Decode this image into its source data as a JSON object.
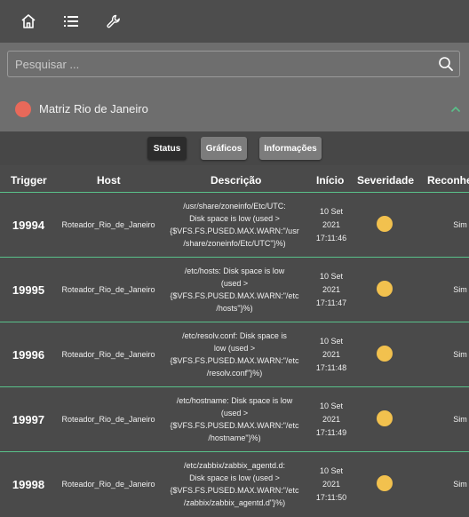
{
  "nav": {
    "icons": [
      "home-icon",
      "list-icon",
      "wrench-icon"
    ]
  },
  "search": {
    "placeholder": "Pesquisar ..."
  },
  "location": {
    "name": "Matriz Rio de Janeiro",
    "status_color": "#e8695a"
  },
  "tabs": [
    {
      "label": "Status",
      "active": true
    },
    {
      "label": "Gráficos",
      "active": false
    },
    {
      "label": "Informações",
      "active": false
    }
  ],
  "table": {
    "headers": [
      "Trigger",
      "Host",
      "Descrição",
      "Início",
      "Severidade",
      "Reconhe"
    ],
    "rows": [
      {
        "trigger": "19994",
        "host": "Roteador_Rio_de_Janeiro",
        "description": [
          "/usr/share/zoneinfo/Etc/UTC:",
          "Disk space is low (used >",
          "{$VFS.FS.PUSED.MAX.WARN:\"/usr",
          "/share/zoneinfo/Etc/UTC\"}%)"
        ],
        "start": [
          "10 Set",
          "2021",
          "17:11:46"
        ],
        "severity_color": "#f2c14e",
        "ack": "Sim"
      },
      {
        "trigger": "19995",
        "host": "Roteador_Rio_de_Janeiro",
        "description": [
          "/etc/hosts: Disk space is low",
          "(used >",
          "{$VFS.FS.PUSED.MAX.WARN:\"/etc",
          "/hosts\"}%)"
        ],
        "start": [
          "10 Set",
          "2021",
          "17:11:47"
        ],
        "severity_color": "#f2c14e",
        "ack": "Sim"
      },
      {
        "trigger": "19996",
        "host": "Roteador_Rio_de_Janeiro",
        "description": [
          "/etc/resolv.conf: Disk space is",
          "low (used >",
          "{$VFS.FS.PUSED.MAX.WARN:\"/etc",
          "/resolv.conf\"}%)"
        ],
        "start": [
          "10 Set",
          "2021",
          "17:11:48"
        ],
        "severity_color": "#f2c14e",
        "ack": "Sim"
      },
      {
        "trigger": "19997",
        "host": "Roteador_Rio_de_Janeiro",
        "description": [
          "/etc/hostname: Disk space is low",
          "(used >",
          "{$VFS.FS.PUSED.MAX.WARN:\"/etc",
          "/hostname\"}%)"
        ],
        "start": [
          "10 Set",
          "2021",
          "17:11:49"
        ],
        "severity_color": "#f2c14e",
        "ack": "Sim"
      },
      {
        "trigger": "19998",
        "host": "Roteador_Rio_de_Janeiro",
        "description": [
          "/etc/zabbix/zabbix_agentd.d:",
          "Disk space is low (used >",
          "{$VFS.FS.PUSED.MAX.WARN:\"/etc",
          "/zabbix/zabbix_agentd.d\"}%)"
        ],
        "start": [
          "10 Set",
          "2021",
          "17:11:50"
        ],
        "severity_color": "#f2c14e",
        "ack": "Sim"
      }
    ]
  }
}
